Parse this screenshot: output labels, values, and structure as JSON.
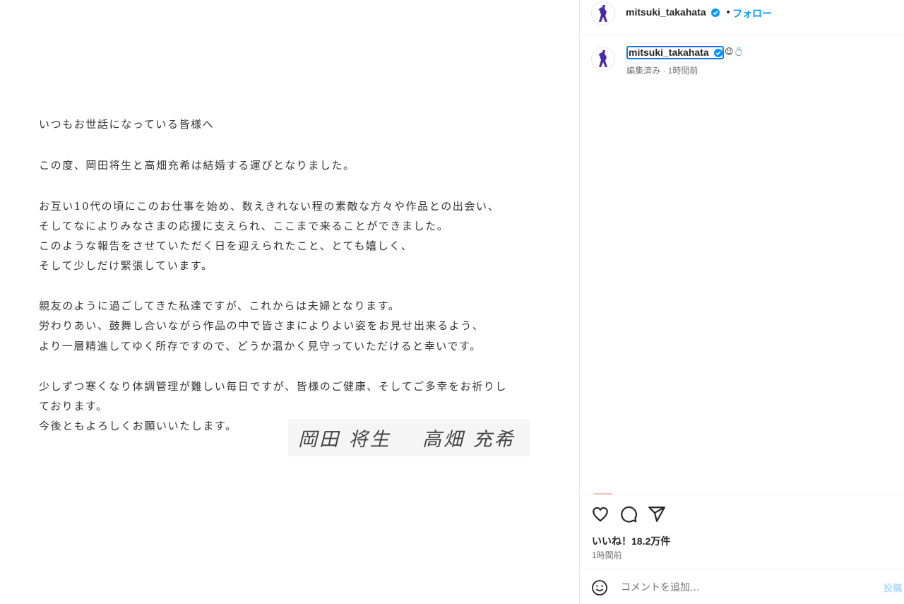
{
  "letter": {
    "lines": [
      "いつもお世話になっている皆様へ",
      "この度、岡田将生と高畑充希は結婚する運びとなりました。",
      "お互い10代の頃にこのお仕事を始め、数えきれない程の素敵な方々や作品との出会い、",
      "そしてなによりみなさまの応援に支えられ、ここまで来ることができました。",
      "このような報告をさせていただく日を迎えられたこと、とても嬉しく、",
      "そして少しだけ緊張しています。",
      "親友のように過ごしてきた私達ですが、これからは夫婦となります。",
      "労わりあい、鼓舞し合いながら作品の中で皆さまによりよい姿をお見せ出来るよう、",
      "より一層精進してゆく所存ですので、どうか温かく見守っていただけると幸いです。",
      "少しずつ寒くなり体調管理が難しい毎日ですが、皆様のご健康、そしてご多幸をお祈りし",
      "ております。",
      "今後ともよろしくお願いいたします。"
    ],
    "signature_left": "岡田 将生",
    "signature_right": "高畑 充希"
  },
  "header": {
    "username": "mitsuki_takahata",
    "separator": "•",
    "follow_label": "フォロー"
  },
  "caption": {
    "username": "mitsuki_takahata",
    "emoji": "☺💍",
    "meta": "編集済み · 1時間前"
  },
  "engagement": {
    "likes": "いいね！18.2万件",
    "time": "1時間前"
  },
  "comment": {
    "placeholder": "コメントを追加...",
    "post_label": "投稿"
  },
  "icons": [
    "verified-badge-icon",
    "heart-icon",
    "comment-icon",
    "share-icon",
    "emoji-icon"
  ],
  "colors": {
    "accent": "#0095f6",
    "avatar_figure": "#4b2aa8"
  }
}
